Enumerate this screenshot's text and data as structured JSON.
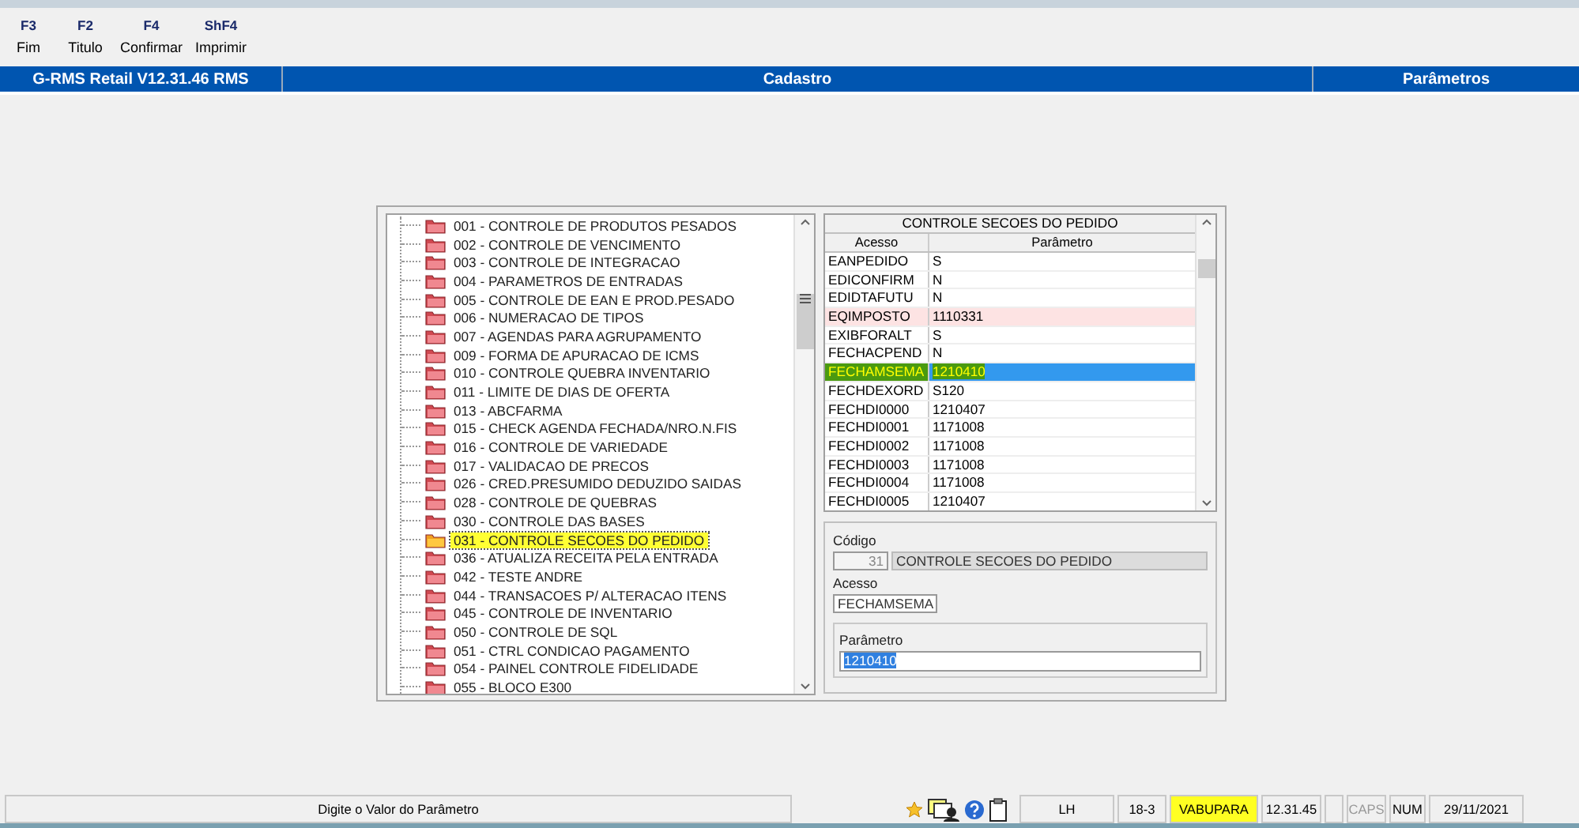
{
  "toolbar": [
    {
      "key": "F3",
      "label": "Fim"
    },
    {
      "key": "F2",
      "label": "Titulo"
    },
    {
      "key": "F4",
      "label": "Confirmar"
    },
    {
      "key": "ShF4",
      "label": "Imprimir"
    }
  ],
  "header": {
    "app": "G-RMS Retail V12.31.46 RMS",
    "module": "Cadastro",
    "screen": "Parâmetros"
  },
  "tree": {
    "items": [
      {
        "label": "001 - CONTROLE DE PRODUTOS PESADOS",
        "selected": false,
        "highlighted": false
      },
      {
        "label": "002 - CONTROLE DE VENCIMENTO",
        "selected": false,
        "highlighted": false
      },
      {
        "label": "003 - CONTROLE DE INTEGRACAO",
        "selected": false,
        "highlighted": false
      },
      {
        "label": "004 - PARAMETROS DE ENTRADAS",
        "selected": false,
        "highlighted": false
      },
      {
        "label": "005 - CONTROLE DE EAN E PROD.PESADO",
        "selected": false,
        "highlighted": false
      },
      {
        "label": "006 - NUMERACAO DE TIPOS",
        "selected": false,
        "highlighted": false
      },
      {
        "label": "007 - AGENDAS PARA AGRUPAMENTO",
        "selected": false,
        "highlighted": false
      },
      {
        "label": "009 - FORMA DE APURACAO DE ICMS",
        "selected": false,
        "highlighted": false
      },
      {
        "label": "010 - CONTROLE QUEBRA INVENTARIO",
        "selected": false,
        "highlighted": false
      },
      {
        "label": "011 - LIMITE DE DIAS DE OFERTA",
        "selected": false,
        "highlighted": false
      },
      {
        "label": "013 - ABCFARMA",
        "selected": false,
        "highlighted": false
      },
      {
        "label": "015 - CHECK AGENDA FECHADA/NRO.N.FIS",
        "selected": false,
        "highlighted": false
      },
      {
        "label": "016 - CONTROLE DE VARIEDADE",
        "selected": false,
        "highlighted": false
      },
      {
        "label": "017 - VALIDACAO DE PRECOS",
        "selected": false,
        "highlighted": false
      },
      {
        "label": "026 - CRED.PRESUMIDO DEDUZIDO SAIDAS",
        "selected": false,
        "highlighted": false
      },
      {
        "label": "028 - CONTROLE DE QUEBRAS",
        "selected": false,
        "highlighted": false
      },
      {
        "label": "030 - CONTROLE DAS BASES",
        "selected": false,
        "highlighted": false
      },
      {
        "label": "031 - CONTROLE SECOES DO PEDIDO",
        "selected": true,
        "highlighted": true
      },
      {
        "label": "036 - ATUALIZA RECEITA PELA ENTRADA",
        "selected": false,
        "highlighted": false
      },
      {
        "label": "042 - TESTE ANDRE",
        "selected": false,
        "highlighted": false
      },
      {
        "label": "044 - TRANSACOES P/ ALTERACAO ITENS",
        "selected": false,
        "highlighted": false
      },
      {
        "label": "045 - CONTROLE DE INVENTARIO",
        "selected": false,
        "highlighted": false
      },
      {
        "label": "050 - CONTROLE DE SQL",
        "selected": false,
        "highlighted": false
      },
      {
        "label": "051 - CTRL CONDICAO PAGAMENTO",
        "selected": false,
        "highlighted": false
      },
      {
        "label": "054 - PAINEL CONTROLE FIDELIDADE",
        "selected": false,
        "highlighted": false
      },
      {
        "label": "055 - BLOCO E300",
        "selected": false,
        "highlighted": false
      }
    ]
  },
  "table": {
    "title": "CONTROLE SECOES DO PEDIDO",
    "columns": [
      "Acesso",
      "Parâmetro"
    ],
    "rows": [
      {
        "acesso": "EANPEDIDO",
        "parametro": "S",
        "selected": false,
        "flagged": false,
        "highlighted": false
      },
      {
        "acesso": "EDICONFIRM",
        "parametro": "N",
        "selected": false,
        "flagged": false,
        "highlighted": false
      },
      {
        "acesso": "EDIDTAFUTU",
        "parametro": "N",
        "selected": false,
        "flagged": false,
        "highlighted": false
      },
      {
        "acesso": "EQIMPOSTO",
        "parametro": "1110331",
        "selected": false,
        "flagged": true,
        "highlighted": false
      },
      {
        "acesso": "EXIBFORALT",
        "parametro": "S",
        "selected": false,
        "flagged": false,
        "highlighted": false
      },
      {
        "acesso": "FECHACPEND",
        "parametro": "N",
        "selected": false,
        "flagged": false,
        "highlighted": false
      },
      {
        "acesso": "FECHAMSEMA",
        "parametro": "1210410",
        "selected": true,
        "flagged": false,
        "highlighted": true
      },
      {
        "acesso": "FECHDEXORD",
        "parametro": "S120",
        "selected": false,
        "flagged": false,
        "highlighted": false
      },
      {
        "acesso": "FECHDI0000",
        "parametro": "1210407",
        "selected": false,
        "flagged": false,
        "highlighted": false
      },
      {
        "acesso": "FECHDI0001",
        "parametro": "1171008",
        "selected": false,
        "flagged": false,
        "highlighted": false
      },
      {
        "acesso": "FECHDI0002",
        "parametro": "1171008",
        "selected": false,
        "flagged": false,
        "highlighted": false
      },
      {
        "acesso": "FECHDI0003",
        "parametro": "1171008",
        "selected": false,
        "flagged": false,
        "highlighted": false
      },
      {
        "acesso": "FECHDI0004",
        "parametro": "1171008",
        "selected": false,
        "flagged": false,
        "highlighted": false
      },
      {
        "acesso": "FECHDI0005",
        "parametro": "1210407",
        "selected": false,
        "flagged": false,
        "highlighted": false
      }
    ]
  },
  "form": {
    "codigo_label": "Código",
    "codigo": "31",
    "descricao": "CONTROLE SECOES DO PEDIDO",
    "acesso_label": "Acesso",
    "acesso": "FECHAMSEMA",
    "parametro_label": "Parâmetro",
    "parametro": "1210410",
    "parametro_selected": true
  },
  "status_bar": {
    "message": "Digite o Valor do Parâmetro",
    "cells": [
      {
        "text": "LH",
        "highlighted": false,
        "disabled": false
      },
      {
        "text": "18-3",
        "highlighted": false,
        "disabled": false
      },
      {
        "text": "VABUPARA",
        "highlighted": true,
        "disabled": false
      },
      {
        "text": "12.31.45",
        "highlighted": false,
        "disabled": false
      },
      {
        "text": "CAPS",
        "highlighted": false,
        "disabled": true
      },
      {
        "text": "NUM",
        "highlighted": false,
        "disabled": false
      },
      {
        "text": "29/11/2021",
        "highlighted": false,
        "disabled": false
      }
    ]
  }
}
